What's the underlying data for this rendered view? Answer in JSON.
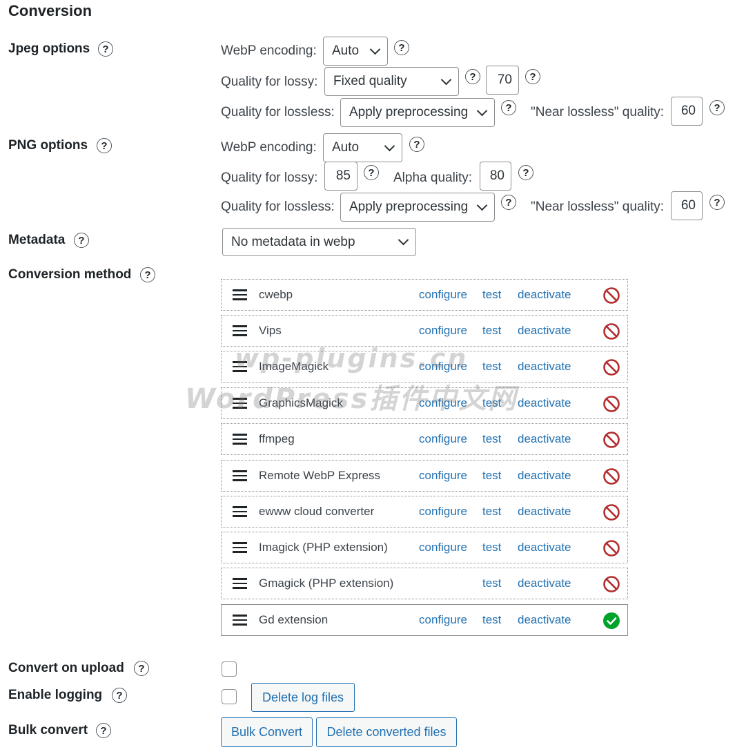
{
  "section_title": "Conversion",
  "help_glyph": "?",
  "jpeg": {
    "label": "Jpeg options",
    "encoding_label": "WebP encoding:",
    "encoding_value": "Auto",
    "lossy_label": "Quality for lossy:",
    "lossy_value": "Fixed quality",
    "lossy_quality": "70",
    "lossless_label": "Quality for lossless:",
    "lossless_value": "Apply preprocessing",
    "near_lossless_label": "\"Near lossless\" quality:",
    "near_lossless_value": "60"
  },
  "png": {
    "label": "PNG options",
    "encoding_label": "WebP encoding:",
    "encoding_value": "Auto",
    "lossy_label": "Quality for lossy:",
    "lossy_quality": "85",
    "alpha_label": "Alpha quality:",
    "alpha_value": "80",
    "lossless_label": "Quality for lossless:",
    "lossless_value": "Apply preprocessing",
    "near_lossless_label": "\"Near lossless\" quality:",
    "near_lossless_value": "60"
  },
  "metadata": {
    "label": "Metadata",
    "value": "No metadata in webp"
  },
  "conversion_method": {
    "label": "Conversion method",
    "link_configure": "configure",
    "link_test": "test",
    "link_deactivate": "deactivate",
    "converters": [
      {
        "name": "cwebp",
        "configure": true,
        "status": "unavailable"
      },
      {
        "name": "Vips",
        "configure": true,
        "status": "unavailable"
      },
      {
        "name": "ImageMagick",
        "configure": true,
        "status": "unavailable"
      },
      {
        "name": "GraphicsMagick",
        "configure": true,
        "status": "unavailable"
      },
      {
        "name": "ffmpeg",
        "configure": true,
        "status": "unavailable"
      },
      {
        "name": "Remote WebP Express",
        "configure": true,
        "status": "unavailable"
      },
      {
        "name": "ewww cloud converter",
        "configure": true,
        "status": "unavailable"
      },
      {
        "name": "Imagick (PHP extension)",
        "configure": true,
        "status": "unavailable"
      },
      {
        "name": "Gmagick (PHP extension)",
        "configure": false,
        "status": "unavailable"
      },
      {
        "name": "Gd extension",
        "configure": true,
        "status": "working"
      }
    ]
  },
  "convert_on_upload": {
    "label": "Convert on upload",
    "checked": false
  },
  "enable_logging": {
    "label": "Enable logging",
    "checked": false,
    "button": "Delete log files"
  },
  "bulk_convert": {
    "label": "Bulk convert",
    "button_convert": "Bulk Convert",
    "button_delete": "Delete converted files"
  },
  "watermark": {
    "line1": "wp-plugins.cn",
    "line2": "WordPress插件中文网"
  },
  "colors": {
    "link": "#2271b1",
    "error": "#b32d2e",
    "success": "#00a32a"
  }
}
